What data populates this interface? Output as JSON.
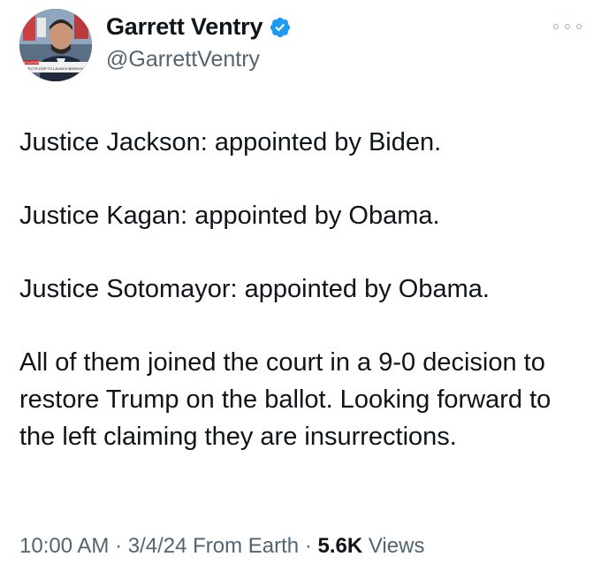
{
  "author": {
    "display_name": "Garrett Ventry",
    "handle": "@GarrettVentry",
    "verified": true,
    "avatar_banner_tag": "INCLUSIVE",
    "avatar_banner_text": "DIRECTS GOP TO LAUNCH BIDEN IMPEACHM"
  },
  "tweet": {
    "paragraphs": [
      "Justice Jackson: appointed by Biden.",
      "Justice Kagan: appointed by Obama.",
      "Justice Sotomayor: appointed by Obama.",
      "All of them joined the court in a 9-0 decision to restore Trump on the ballot. Looking forward to the left claiming they are insurrections."
    ]
  },
  "meta": {
    "time": "10:00 AM",
    "separator": " · ",
    "date_source": "3/4/24 From Earth",
    "views_count": "5.6K",
    "views_label": " Views"
  },
  "icons": {
    "verified": "verified-badge-icon",
    "more": "more-options-icon"
  },
  "colors": {
    "verified_blue": "#1d9bf0",
    "text_primary": "#0f1419",
    "text_secondary": "#536471"
  }
}
